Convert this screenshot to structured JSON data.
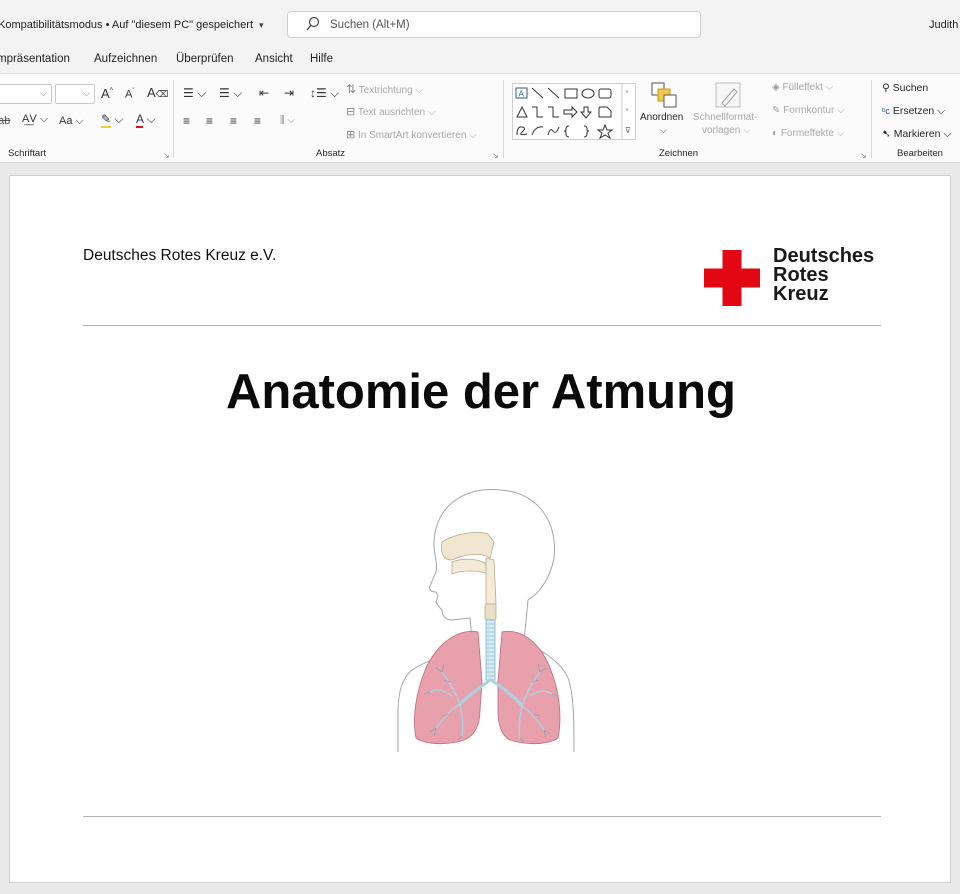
{
  "titlebar": {
    "doc_title": "Kompatibilitätsmodus • Auf \"diesem PC\" gespeichert",
    "search_placeholder": "Suchen (Alt+M)",
    "user": "Judith"
  },
  "menu": {
    "items": [
      "mpräsentation",
      "Aufzeichnen",
      "Überprüfen",
      "Ansicht",
      "Hilfe"
    ]
  },
  "ribbon": {
    "schriftart": {
      "label": "Schriftart"
    },
    "absatz": {
      "label": "Absatz",
      "textrichtung": "Textrichtung",
      "text_ausrichten": "Text ausrichten",
      "smartart": "In SmartArt konvertieren"
    },
    "zeichnen": {
      "label": "Zeichnen",
      "anordnen": "Anordnen",
      "schnellformat_1": "Schnellformat-",
      "schnellformat_2": "vorlagen",
      "fuelleffekt": "Fülleffekt",
      "formkontur": "Formkontur",
      "formeffekte": "Formeffekte"
    },
    "bearbeiten": {
      "label": "Bearbeiten",
      "suchen": "Suchen",
      "ersetzen": "Ersetzen",
      "markieren": "Markieren"
    }
  },
  "slide": {
    "org": "Deutsches Rotes Kreuz e.V.",
    "logo_lines": [
      "Deutsches",
      "Rotes",
      "Kreuz"
    ],
    "title": "Anatomie der Atmung"
  },
  "colors": {
    "drk_red": "#e30613",
    "lung_pink": "#e8a1ac",
    "bronchi_blue": "#a8d4e4"
  }
}
